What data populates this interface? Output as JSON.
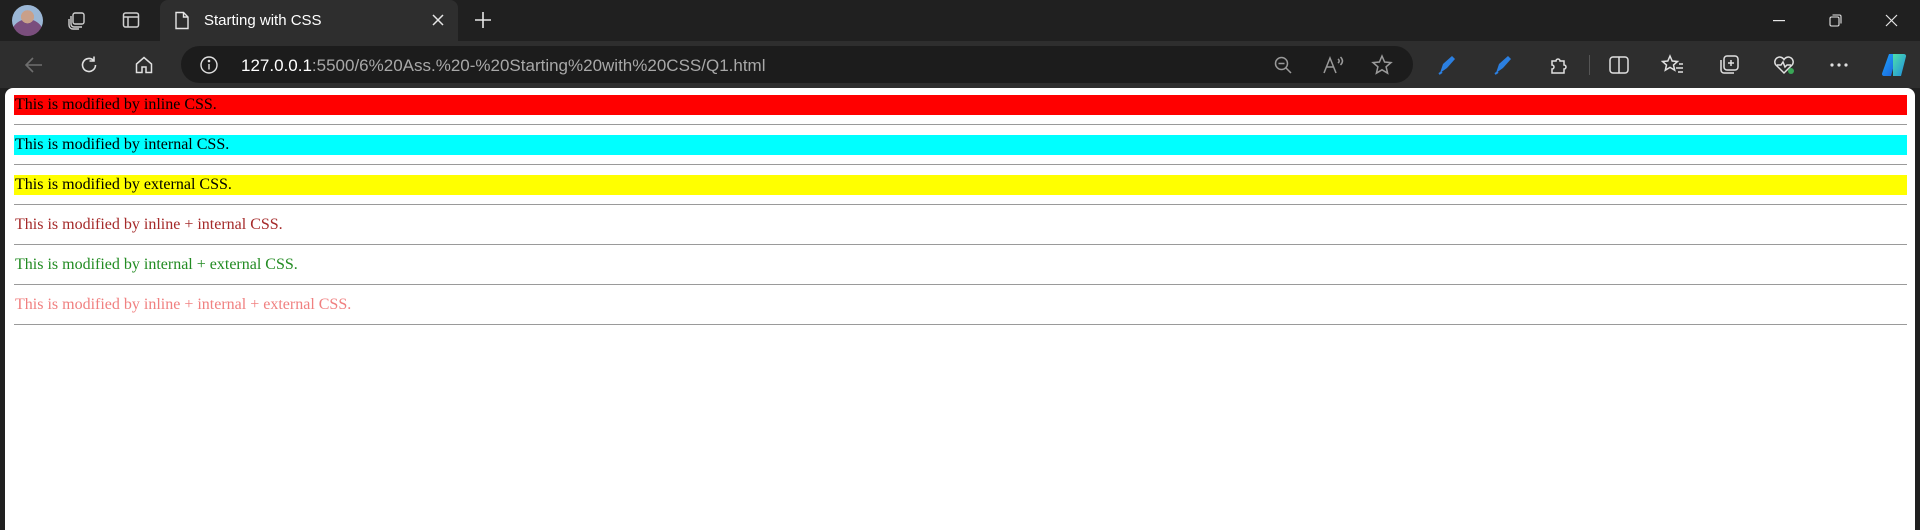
{
  "browser": {
    "tab": {
      "title": "Starting with CSS"
    },
    "address": {
      "host": "127.0.0.1",
      "rest": ":5500/6%20Ass.%20-%20Starting%20with%20CSS/Q1.html"
    },
    "icons": [
      "profile-avatar",
      "workspaces-icon",
      "tab-actions-icon",
      "page-icon",
      "close-icon",
      "new-tab-icon",
      "minimize-icon",
      "restore-icon",
      "close-window-icon",
      "back-icon",
      "refresh-icon",
      "home-icon",
      "site-info-icon",
      "zoom-out-icon",
      "read-aloud-icon",
      "favorite-star-icon",
      "extension-pen-icon",
      "extension-pen-icon",
      "extensions-icon",
      "split-screen-icon",
      "favorites-icon",
      "collections-icon",
      "browser-essentials-icon",
      "more-icon",
      "copilot-icon"
    ]
  },
  "page": {
    "lines": [
      {
        "text": "This is modified by inline CSS.",
        "color": "#000000",
        "background": "#ff0000"
      },
      {
        "text": "This is modified by internal CSS.",
        "color": "#000000",
        "background": "#00ffff"
      },
      {
        "text": "This is modified by external CSS.",
        "color": "#000000",
        "background": "#ffff00"
      },
      {
        "text": "This is modified by inline + internal CSS.",
        "color": "#a52a2a",
        "background": ""
      },
      {
        "text": "This is modified by internal + external CSS.",
        "color": "#228b22",
        "background": ""
      },
      {
        "text": "This is modified by inline + internal + external CSS.",
        "color": "#f08080",
        "background": ""
      }
    ]
  }
}
